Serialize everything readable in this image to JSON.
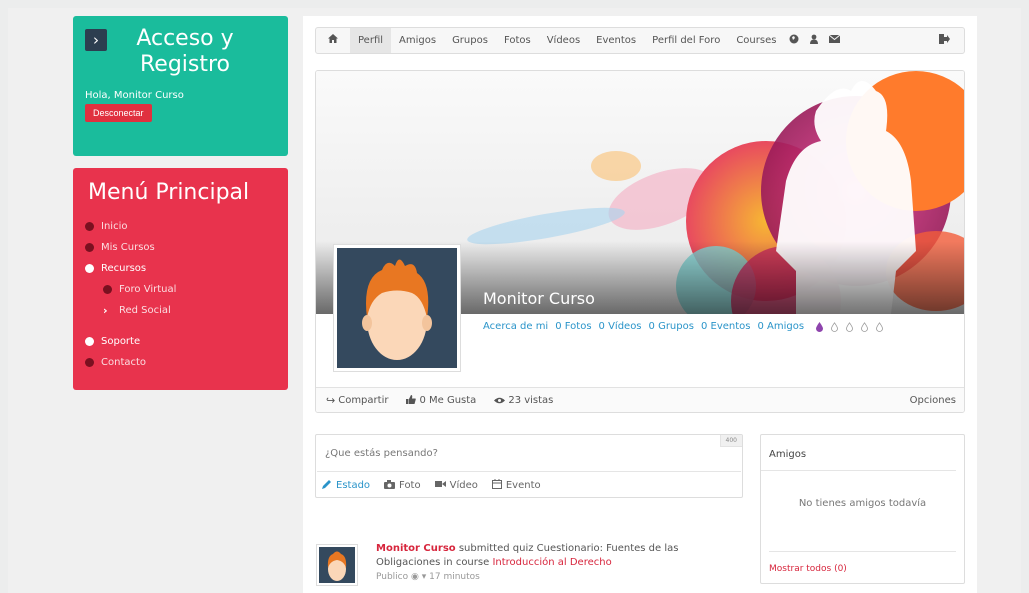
{
  "sidebar": {
    "access": {
      "title": "Acceso y Registro",
      "greeting": "Hola, Monitor Curso",
      "logout_label": "Desconectar"
    },
    "menu": {
      "title": "Menú Principal",
      "items": [
        {
          "label": "Inicio"
        },
        {
          "label": "Mis Cursos"
        },
        {
          "label": "Recursos"
        },
        {
          "label": "Foro Virtual"
        },
        {
          "label": "Red Social"
        },
        {
          "label": "Soporte"
        },
        {
          "label": "Contacto"
        }
      ]
    }
  },
  "topnav": {
    "home_icon": "home-icon",
    "tabs": [
      {
        "label": "Perfil"
      },
      {
        "label": "Amigos"
      },
      {
        "label": "Grupos"
      },
      {
        "label": "Fotos"
      },
      {
        "label": "Vídeos"
      },
      {
        "label": "Eventos"
      },
      {
        "label": "Perfil del Foro"
      },
      {
        "label": "Courses"
      }
    ],
    "icons": [
      "globe-icon",
      "user-icon",
      "envelope-icon",
      "logout-icon"
    ]
  },
  "profile": {
    "name": "Monitor Curso",
    "links": {
      "about": "Acerca de mi",
      "photos": "0 Fotos",
      "videos": "0 Vídeos",
      "groups": "0 Grupos",
      "events": "0 Eventos",
      "friends": "0 Amigos"
    },
    "share": {
      "share_label": "Compartir",
      "likes_label": "0 Me Gusta",
      "views_label": "23 vistas",
      "options_label": "Opciones"
    }
  },
  "status": {
    "placeholder": "¿Que estás pensando?",
    "char_count": "400",
    "tabs": [
      {
        "label": "Estado"
      },
      {
        "label": "Foto"
      },
      {
        "label": "Vídeo"
      },
      {
        "label": "Evento"
      }
    ]
  },
  "feed": {
    "author": "Monitor Curso",
    "action": " submitted quiz Cuestionario: Fuentes de las Obligaciones in course ",
    "course": "Introducción al Derecho",
    "privacy": "Publico",
    "time": "17 minutos"
  },
  "friends_box": {
    "title": "Amigos",
    "empty_text": "No tienes amigos todavía",
    "show_all": "Mostrar todos (0)"
  },
  "colors": {
    "teal": "#1abc9c",
    "red": "#e8334d",
    "link": "#2a94c9",
    "dark": "#34495e"
  }
}
